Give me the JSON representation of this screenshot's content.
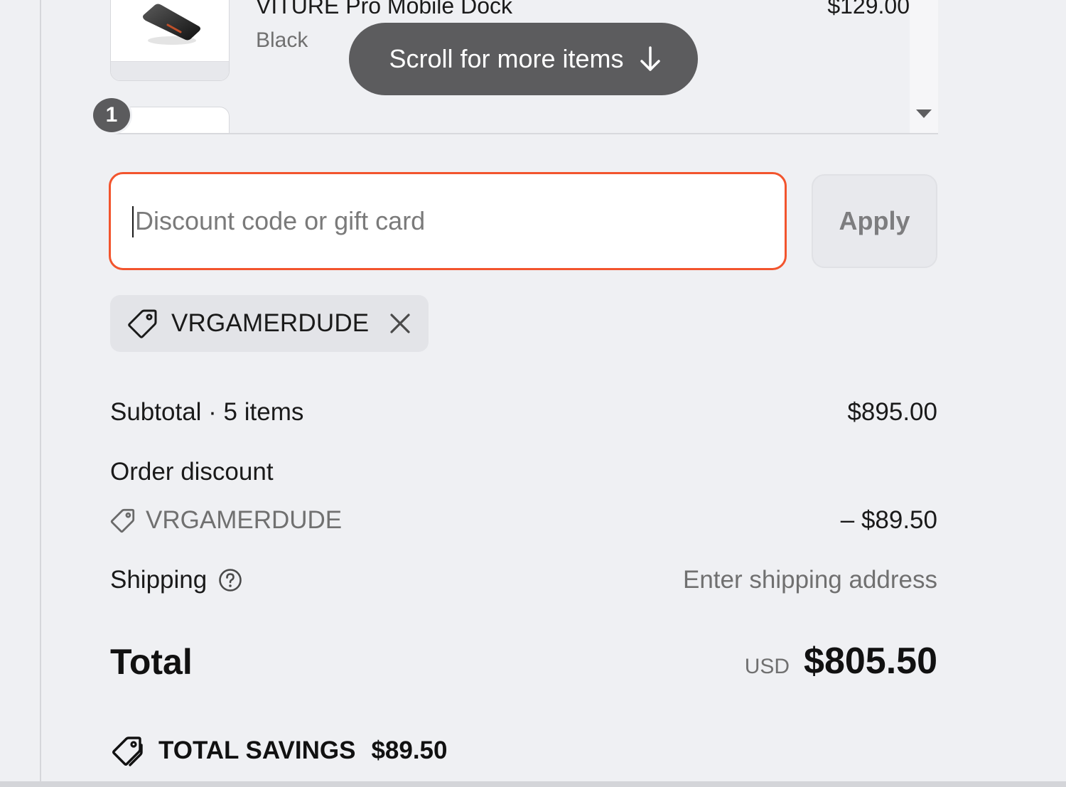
{
  "line_item": {
    "name": "VITURE Pro Mobile Dock",
    "variant": "Black",
    "price": "$129.00",
    "quantity": "1",
    "image_icon": "product-dock-icon"
  },
  "scroll_hint": {
    "label": "Scroll for more items",
    "icon": "arrow-down-icon"
  },
  "discount": {
    "placeholder": "Discount code or gift card",
    "value": "",
    "apply_label": "Apply",
    "applied_code": "VRGAMERDUDE"
  },
  "summary": {
    "subtotal_label": "Subtotal · 5 items",
    "subtotal_value": "$895.00",
    "order_discount_label": "Order discount",
    "order_discount_code": "VRGAMERDUDE",
    "order_discount_value": "– $89.50",
    "shipping_label": "Shipping",
    "shipping_value": "Enter shipping address",
    "total_label": "Total",
    "total_currency": "USD",
    "total_amount": "$805.50",
    "savings_label": "TOTAL SAVINGS",
    "savings_amount": "$89.50"
  },
  "colors": {
    "accent_focus": "#f2542d",
    "background": "#eff0f3",
    "muted_text": "#707070"
  }
}
